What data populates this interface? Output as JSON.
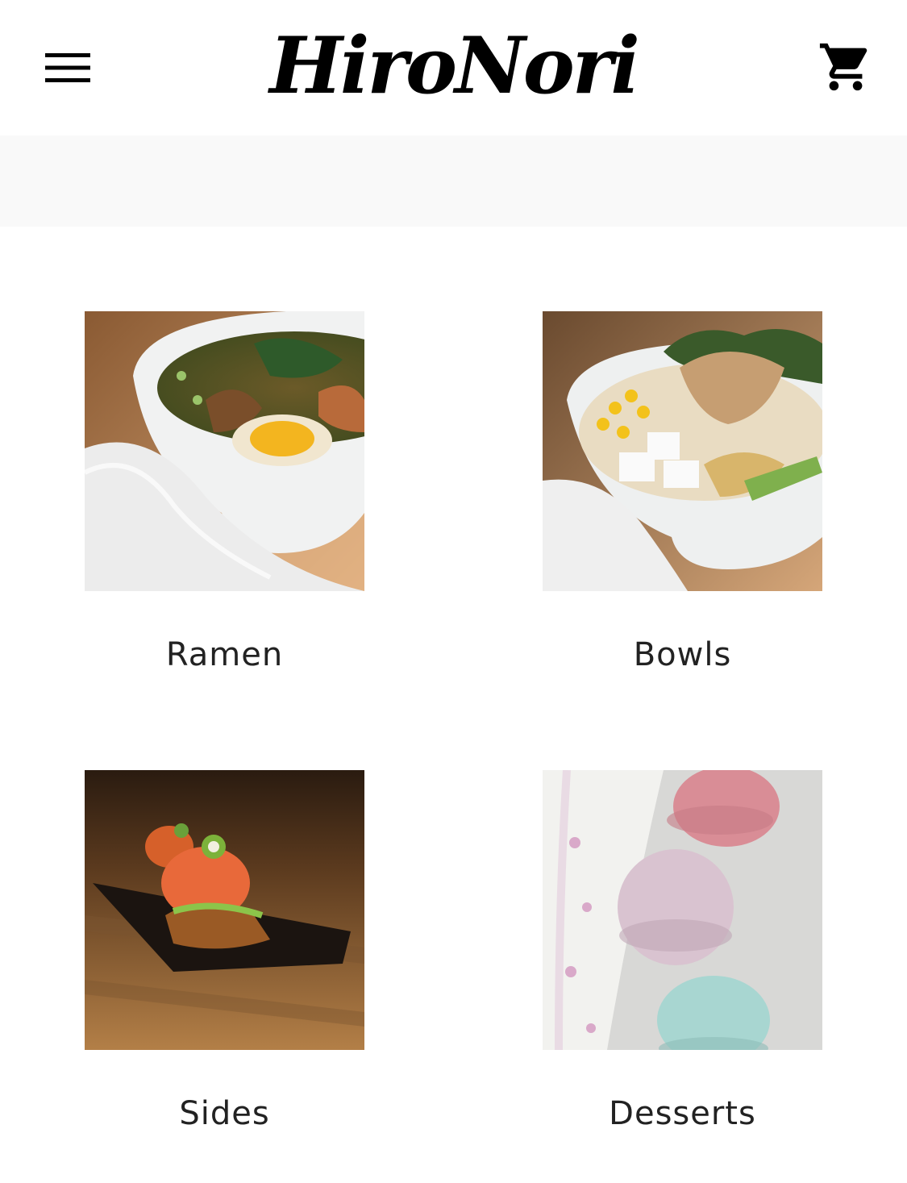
{
  "header": {
    "brand": "HiroNori",
    "menu_icon": "hamburger-menu-icon",
    "cart_icon": "shopping-cart-icon"
  },
  "categories": [
    {
      "label": "Ramen",
      "image": "ramen-bowl-photo"
    },
    {
      "label": "Bowls",
      "image": "rice-bowl-photo"
    },
    {
      "label": "Sides",
      "image": "sides-appetizer-photo"
    },
    {
      "label": "Desserts",
      "image": "macarons-photo"
    }
  ],
  "colors": {
    "text": "#222222",
    "brand": "#000000",
    "strip": "#f9f9f9",
    "background": "#ffffff"
  }
}
